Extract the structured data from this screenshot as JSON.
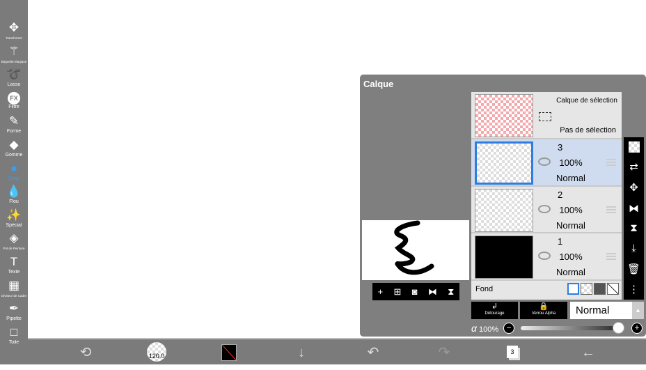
{
  "tools": [
    {
      "label": "Transformer",
      "icon": "move-arrows-icon"
    },
    {
      "label": "Baguette Magique",
      "icon": "magic-wand-icon"
    },
    {
      "label": "Lasso",
      "icon": "lasso-icon"
    },
    {
      "label": "Filtre",
      "icon": "fx-icon"
    },
    {
      "label": "Forme",
      "icon": "brush-icon"
    },
    {
      "label": "Gomme",
      "icon": "eraser-icon"
    },
    {
      "label": "Doigt",
      "icon": "smudge-icon",
      "active": true
    },
    {
      "label": "Flou",
      "icon": "blur-drop-icon"
    },
    {
      "label": "Spécial",
      "icon": "special-wand-icon"
    },
    {
      "label": "Pot de Peinture",
      "icon": "paint-bucket-icon"
    },
    {
      "label": "Texte",
      "icon": "text-icon"
    },
    {
      "label": "Diviseur de Cadre",
      "icon": "frame-divider-icon"
    },
    {
      "label": "Pipette",
      "icon": "eyedropper-icon"
    },
    {
      "label": "Toile",
      "icon": "canvas-icon"
    }
  ],
  "bottom": {
    "brush_size": "120.0",
    "layers_count": "3"
  },
  "panel": {
    "title": "Calque",
    "selection_layer": {
      "title": "Calque de sélection",
      "status": "Pas de sélection"
    },
    "layers": [
      {
        "number": "3",
        "opacity": "100%",
        "blend": "Normal",
        "selected": true
      },
      {
        "number": "2",
        "opacity": "100%",
        "blend": "Normal"
      },
      {
        "number": "1",
        "opacity": "100%",
        "blend": "Normal"
      }
    ],
    "background_label": "Fond",
    "clipping_label": "Détourage",
    "alpha_lock_label": "Verrou Alpha",
    "blend_mode": "Normal",
    "alpha_symbol": "α",
    "opacity": "100%",
    "opacity_value": 1.0
  },
  "colors": {
    "accent": "#3d9be9",
    "selected_row": "#cfdcef",
    "toolbar": "#7b7b7b"
  }
}
